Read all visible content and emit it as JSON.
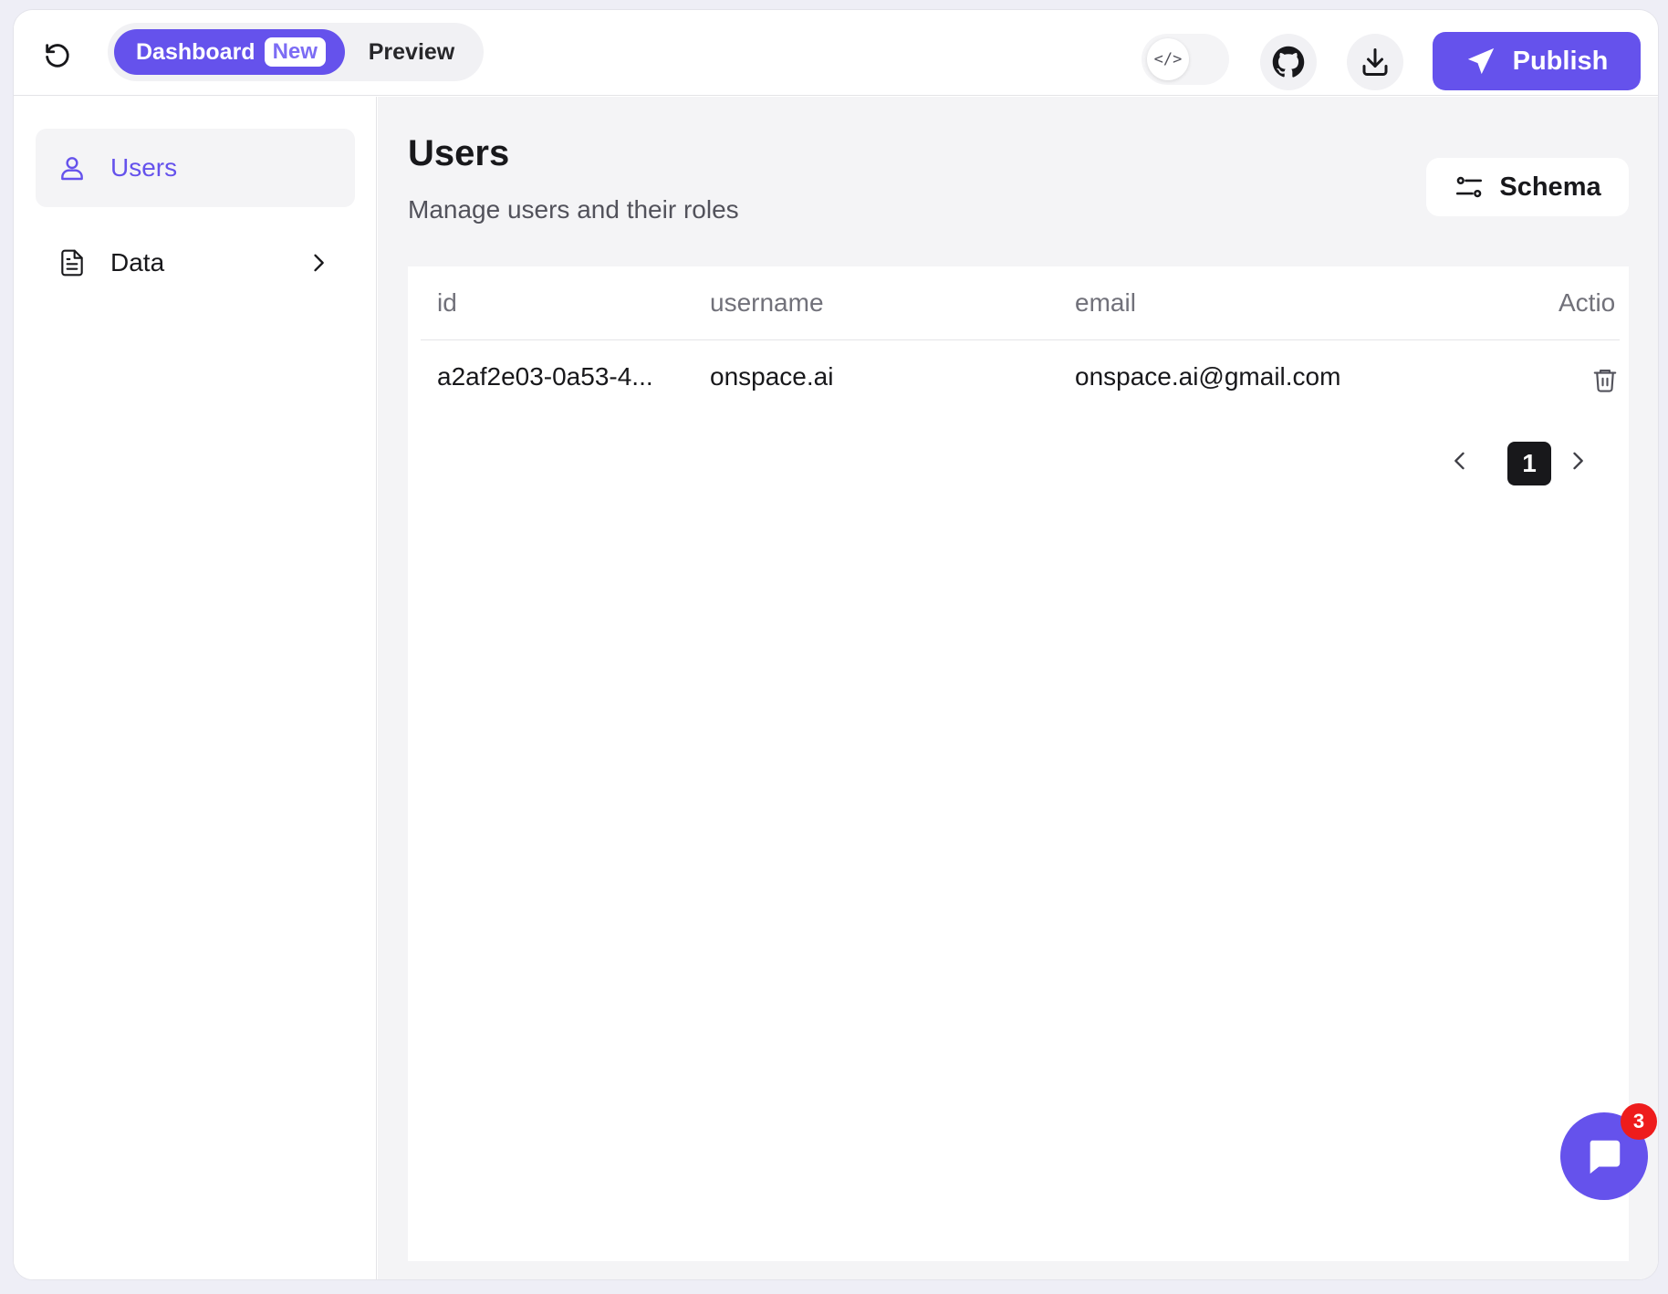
{
  "colors": {
    "accent": "#6552ec",
    "badge_red": "#ee1c1c",
    "page_bg": "#f4f4f6",
    "sidebar_active_bg": "#f4f4f6"
  },
  "topbar": {
    "refresh_icon": "refresh-icon",
    "mode_switch": {
      "dashboard_label": "Dashboard",
      "new_badge": "New",
      "preview_label": "Preview"
    },
    "code_toggle_label": "</>",
    "github_icon": "github-icon",
    "download_icon": "download-icon",
    "publish_label": "Publish",
    "publish_icon": "paper-plane-icon"
  },
  "sidebar": {
    "items": [
      {
        "label": "Users",
        "icon": "user-icon",
        "active": true
      },
      {
        "label": "Data",
        "icon": "document-icon",
        "expandable": true,
        "chevron_icon": "chevron-right-icon"
      }
    ]
  },
  "main": {
    "title": "Users",
    "subtitle": "Manage users and their roles",
    "schema_label": "Schema",
    "schema_icon": "sliders-icon",
    "table": {
      "columns": [
        "id",
        "username",
        "email",
        "Actio"
      ],
      "rows": [
        {
          "id": "a2af2e03-0a53-4...",
          "username": "onspace.ai",
          "email": "onspace.ai@gmail.com",
          "action_icon": "trash-icon"
        }
      ]
    },
    "pagination": {
      "current_page": "1",
      "prev_icon": "chevron-left-icon",
      "next_icon": "chevron-right-icon"
    }
  },
  "chat": {
    "icon": "chat-bubble-icon",
    "unread_count": "3"
  }
}
